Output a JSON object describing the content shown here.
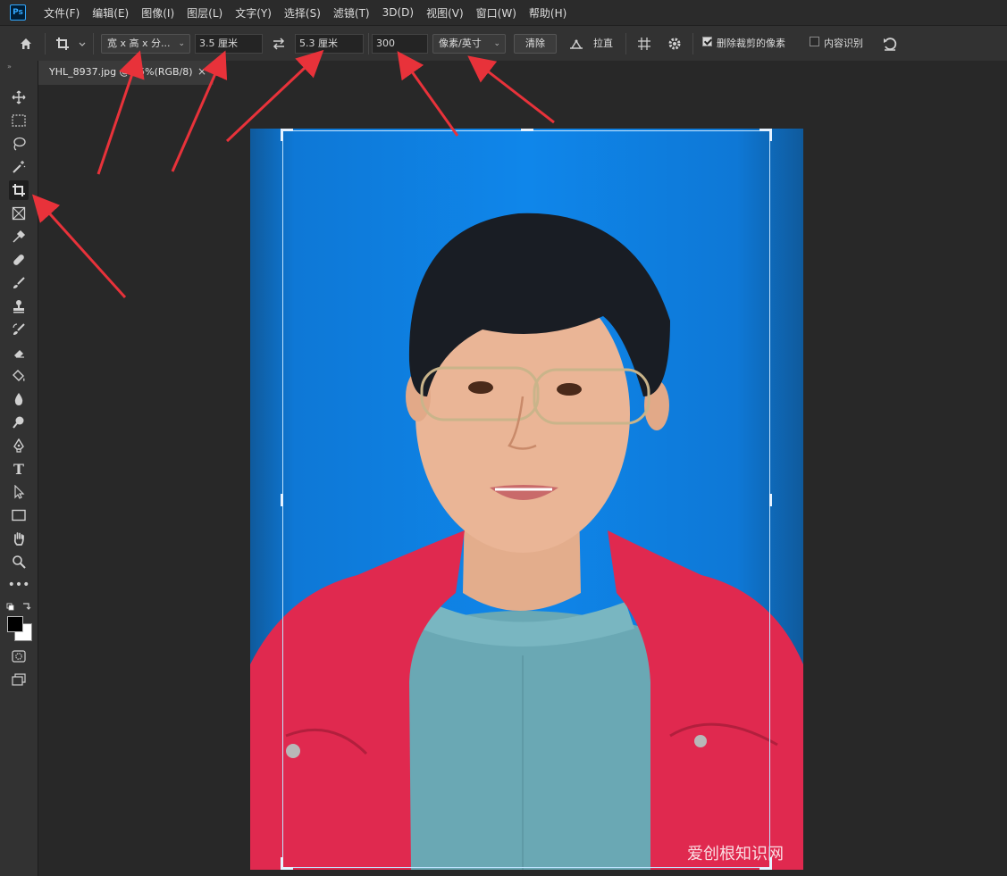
{
  "app": {
    "logo": "Ps"
  },
  "menu": [
    "文件(F)",
    "编辑(E)",
    "图像(I)",
    "图层(L)",
    "文字(Y)",
    "选择(S)",
    "滤镜(T)",
    "3D(D)",
    "视图(V)",
    "窗口(W)",
    "帮助(H)"
  ],
  "options": {
    "ratio_dropdown": "宽 x 高 x 分...",
    "width": "3.5 厘米",
    "height": "5.3 厘米",
    "resolution": "300",
    "unit_dropdown": "像素/英寸",
    "clear_button": "清除",
    "straighten_label": "拉直",
    "delete_cropped_label": "删除裁剪的像素",
    "delete_cropped_checked": true,
    "content_aware_label": "内容识别",
    "content_aware_checked": false
  },
  "document": {
    "tab_title": "YHL_8937.jpg @ 25%(RGB/8)",
    "close": "×"
  },
  "watermark": "爱创根知识网",
  "colors": {
    "accent": "#31a8ff",
    "arrow": "#e8323a",
    "canvas_bg": "#0f86ea",
    "jacket": "#e0294f"
  },
  "tools": [
    "move-icon",
    "marquee-icon",
    "lasso-icon",
    "magic-wand-icon",
    "crop-icon",
    "frame-icon",
    "eyedropper-icon",
    "healing-brush-icon",
    "brush-icon",
    "clone-stamp-icon",
    "history-brush-icon",
    "eraser-icon",
    "paint-bucket-icon",
    "blur-icon",
    "dodge-icon",
    "pen-icon",
    "type-icon",
    "path-selection-icon",
    "rectangle-icon",
    "hand-icon",
    "zoom-icon",
    "more-icon",
    "swap-colors-icon",
    "color-swatches-icon",
    "quick-mask-icon",
    "screen-mode-icon"
  ]
}
